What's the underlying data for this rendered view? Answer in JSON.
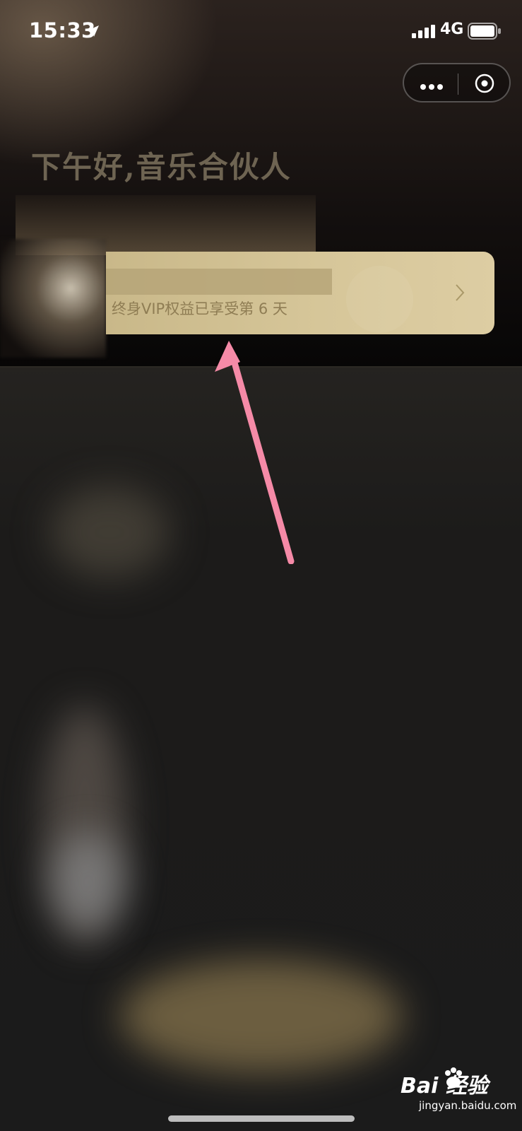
{
  "status_bar": {
    "time": "15:33",
    "network": "4G",
    "icons": [
      "location-arrow-icon",
      "signal-bars-icon",
      "battery-icon"
    ]
  },
  "capsule": {
    "icons": [
      "more-dots-icon",
      "close-target-icon"
    ]
  },
  "greeting": "下午好,音乐合伙人",
  "vip_card": {
    "status_text": "终身VIP权益已享受第 6 天",
    "icon": "chevron-right-icon"
  },
  "watermark": {
    "brand": "Bai  经验",
    "url": "jingyan.baidu.com"
  },
  "colors": {
    "card_gold": "#d6c699",
    "card_text": "#8f7d54",
    "greeting_text": "#6e6452",
    "annotation_pink": "#f58aa7"
  }
}
